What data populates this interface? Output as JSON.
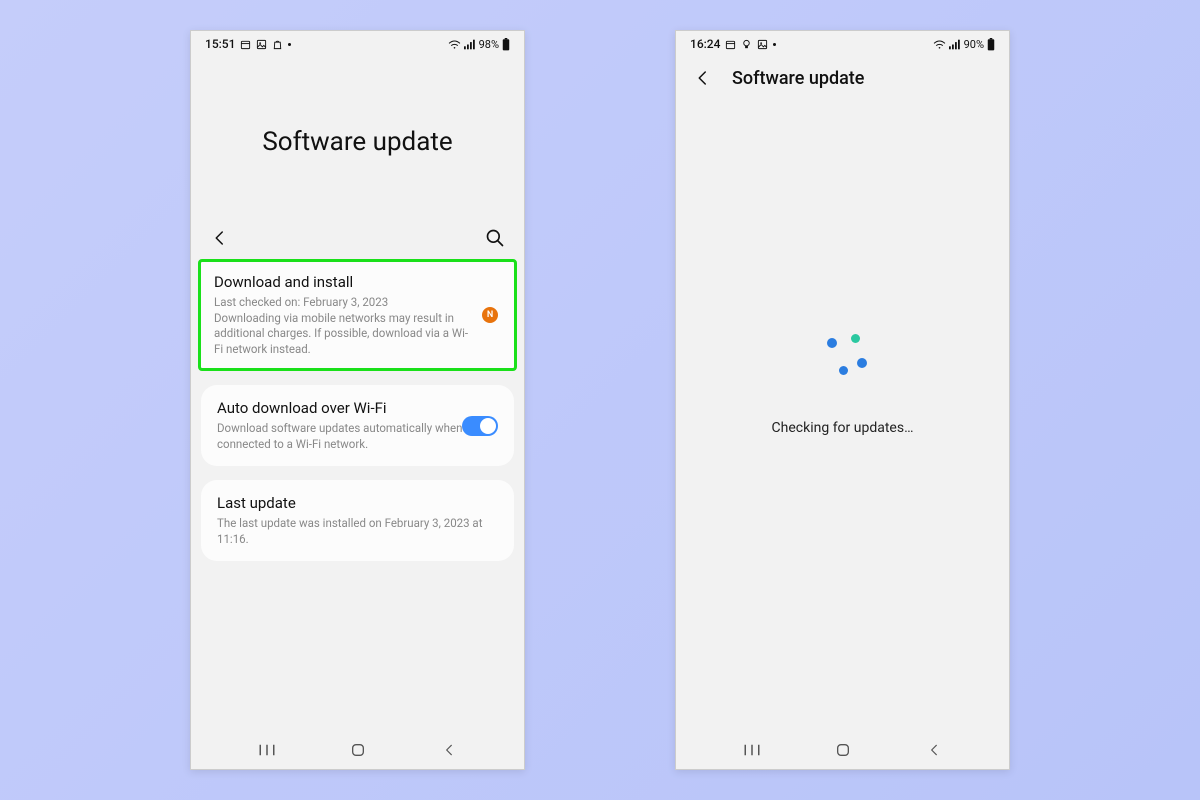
{
  "left": {
    "status": {
      "time": "15:51",
      "battery": "98%"
    },
    "page_title": "Software update",
    "download_install": {
      "title": "Download and install",
      "line1": "Last checked on: February 3, 2023",
      "line2": "Downloading via mobile networks may result in additional charges. If possible, download via a Wi-Fi network instead.",
      "badge": "N"
    },
    "auto_download": {
      "title": "Auto download over Wi-Fi",
      "sub": "Download software updates automatically when connected to a Wi-Fi network.",
      "toggle_on": true
    },
    "last_update": {
      "title": "Last update",
      "sub": "The last update was installed on February 3, 2023 at 11:16."
    }
  },
  "right": {
    "status": {
      "time": "16:24",
      "battery": "90%"
    },
    "page_title": "Software update",
    "checking_text": "Checking for updates…"
  }
}
